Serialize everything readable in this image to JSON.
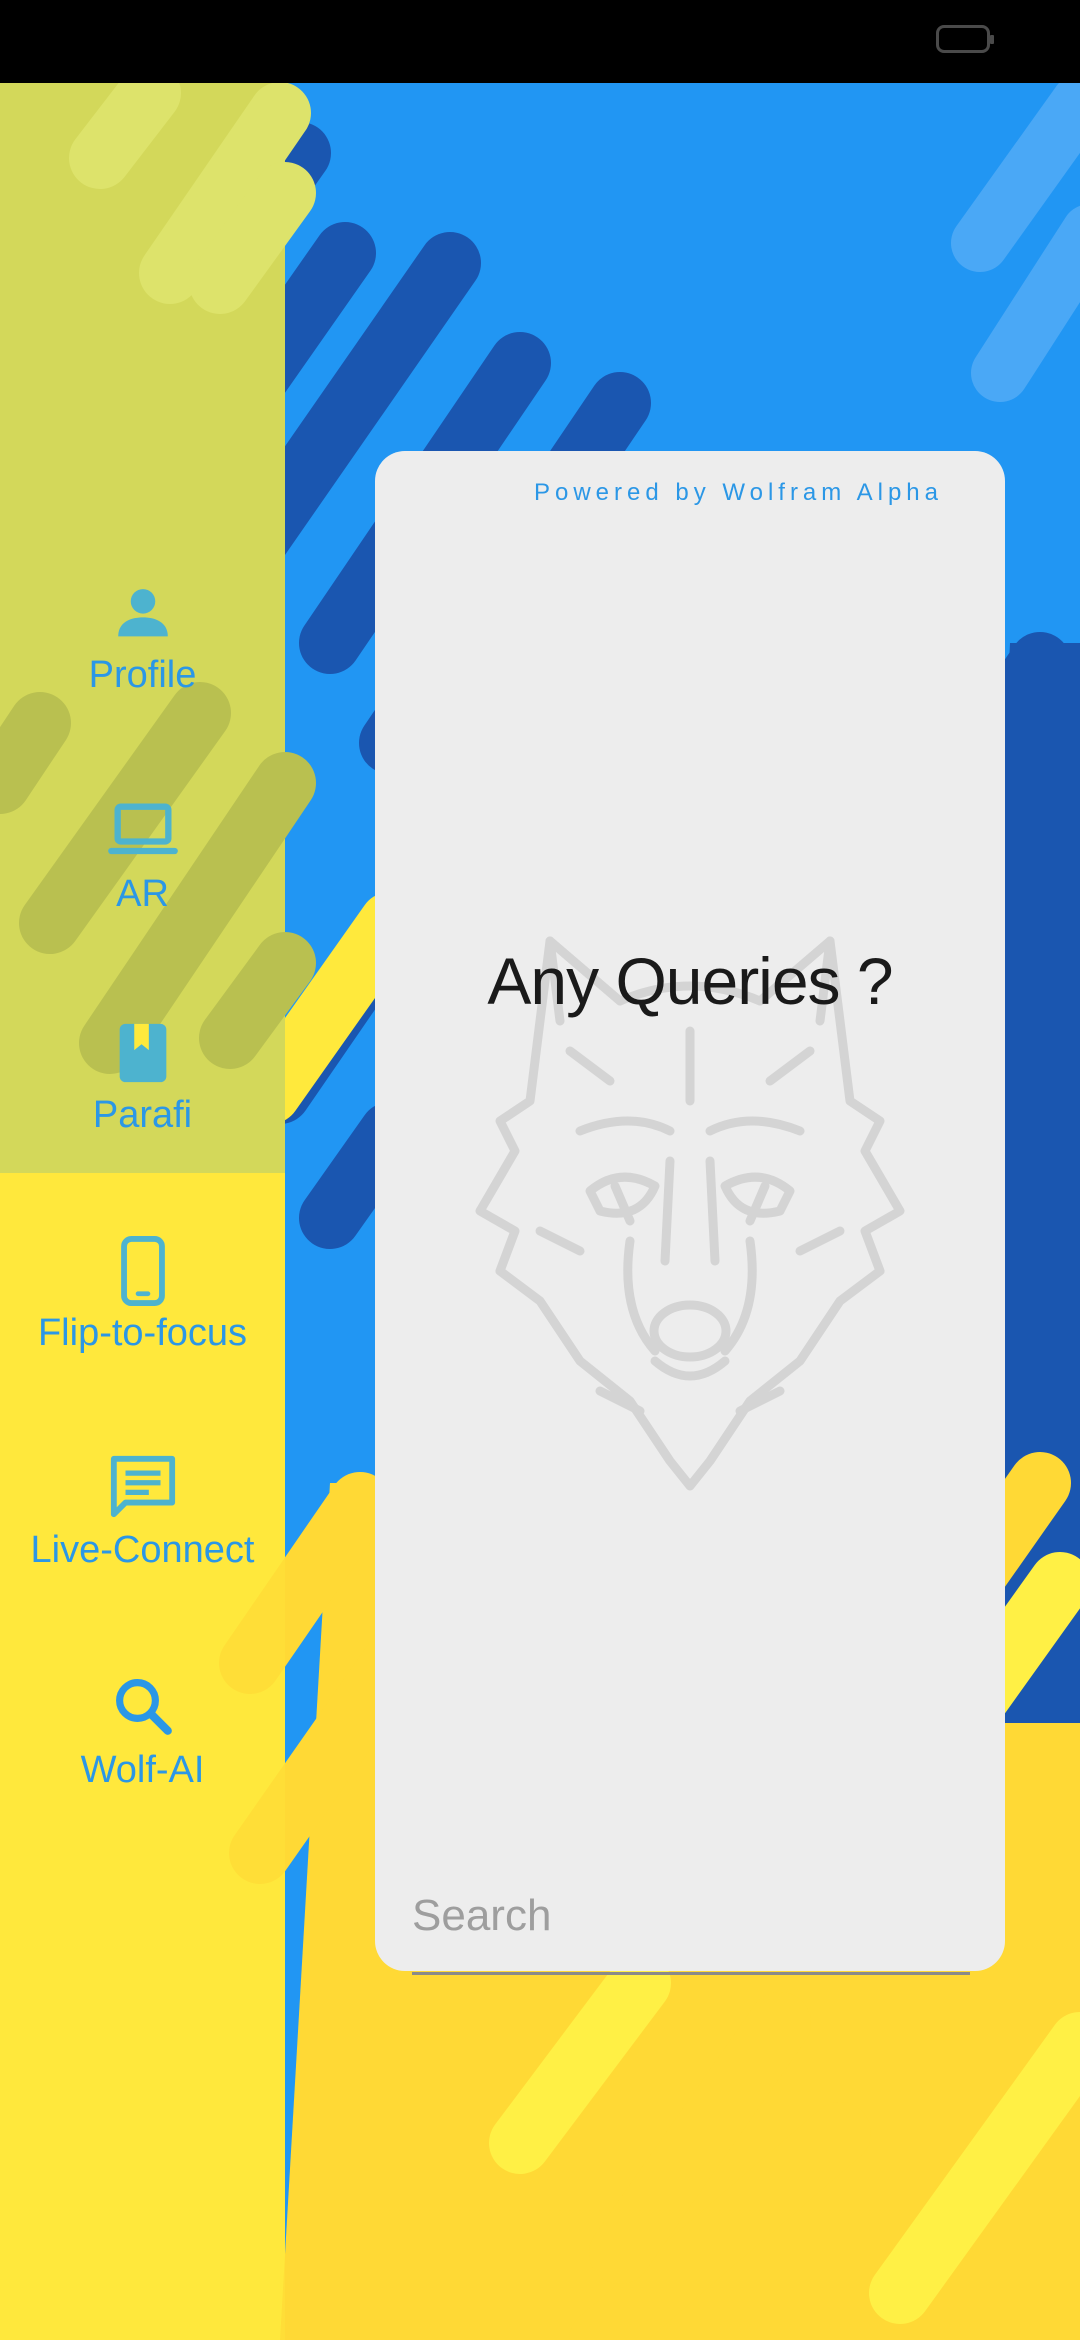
{
  "status_bar": {
    "battery_icon": "battery-icon"
  },
  "colors": {
    "accent": "#2b97e6",
    "background_yellow": "#ffe93c",
    "background_blue": "#2196f3",
    "background_dark_blue": "#1a56b0",
    "sidebar_overlay": "#d3d85a",
    "card_background": "#ededed"
  },
  "sidebar": {
    "items": [
      {
        "label": "Profile",
        "icon": "person-icon"
      },
      {
        "label": "AR",
        "icon": "laptop-icon"
      },
      {
        "label": "Parafi",
        "icon": "book-icon"
      },
      {
        "label": "Flip-to-focus",
        "icon": "phone-icon"
      },
      {
        "label": "Live-Connect",
        "icon": "chat-icon"
      },
      {
        "label": "Wolf-AI",
        "icon": "search-icon"
      }
    ]
  },
  "card": {
    "powered_by": "Powered by Wolfram Alpha",
    "question": "Any Queries ?",
    "watermark_icon": "wolf-icon"
  },
  "search": {
    "placeholder": "Search",
    "value": ""
  }
}
